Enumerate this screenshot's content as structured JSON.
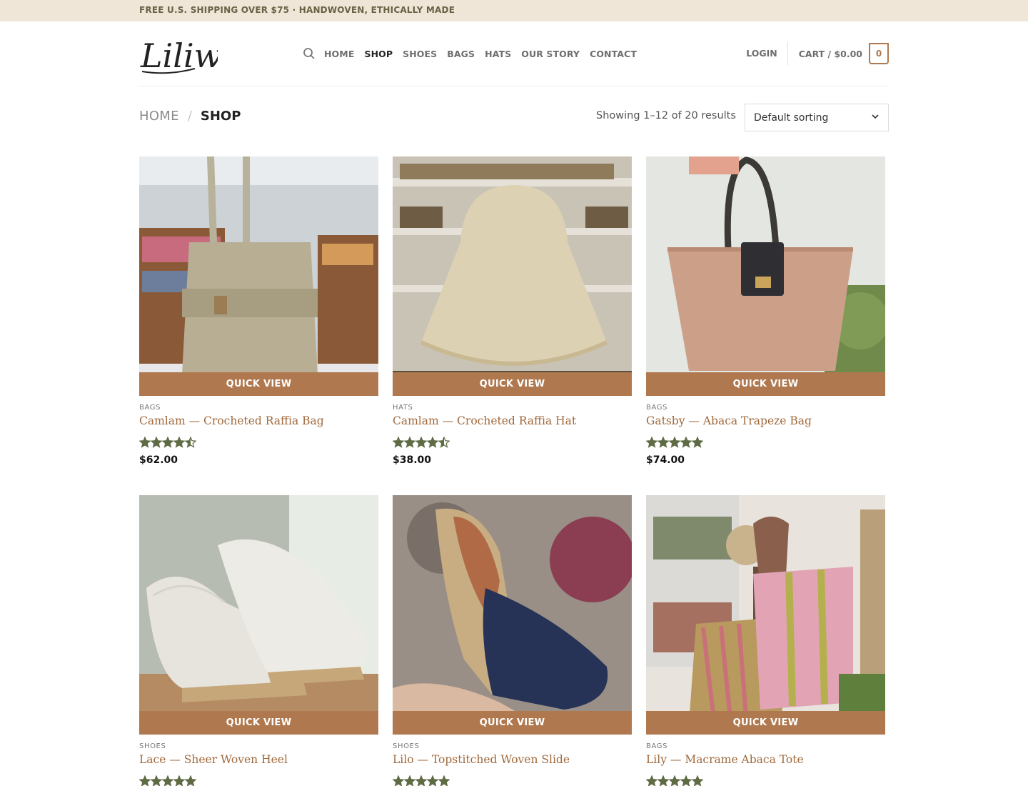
{
  "topbar": {
    "text": "FREE U.S. SHIPPING OVER $75 · HANDWOVEN, ETHICALLY MADE"
  },
  "brand": {
    "logo_text": "Liliw"
  },
  "nav": {
    "items": [
      {
        "label": "HOME",
        "active": false
      },
      {
        "label": "SHOP",
        "active": true
      },
      {
        "label": "SHOES",
        "active": false
      },
      {
        "label": "BAGS",
        "active": false
      },
      {
        "label": "HATS",
        "active": false
      },
      {
        "label": "OUR STORY",
        "active": false
      },
      {
        "label": "CONTACT",
        "active": false
      }
    ]
  },
  "account": {
    "login": "LOGIN",
    "cart": "CART / $0.00",
    "cart_count": "0"
  },
  "breadcrumb": {
    "home": "HOME",
    "sep": "/",
    "current": "SHOP"
  },
  "results": "Showing 1–12 of 20 results",
  "sorting": {
    "selected": "Default sorting"
  },
  "quick_view_label": "QUICK VIEW",
  "products": [
    {
      "category": "BAGS",
      "name": "Camlam — Crocheted Raffia Bag",
      "rating": 4.5,
      "price": "$62.00"
    },
    {
      "category": "HATS",
      "name": "Camlam — Crocheted Raffia Hat",
      "rating": 4.5,
      "price": "$38.00"
    },
    {
      "category": "BAGS",
      "name": "Gatsby — Abaca Trapeze Bag",
      "rating": 5,
      "price": "$74.00"
    },
    {
      "category": "SHOES",
      "name": "Lace — Sheer Woven Heel",
      "rating": 5,
      "price": ""
    },
    {
      "category": "SHOES",
      "name": "Lilo — Topstitched Woven Slide",
      "rating": 5,
      "price": ""
    },
    {
      "category": "BAGS",
      "name": "Lily — Macrame Abaca Tote",
      "rating": 5,
      "price": ""
    }
  ],
  "colors": {
    "accent": "#b0784e",
    "product_name": "#a0693c",
    "star": "#5e6b45",
    "topbar_bg": "#efe6d8"
  }
}
